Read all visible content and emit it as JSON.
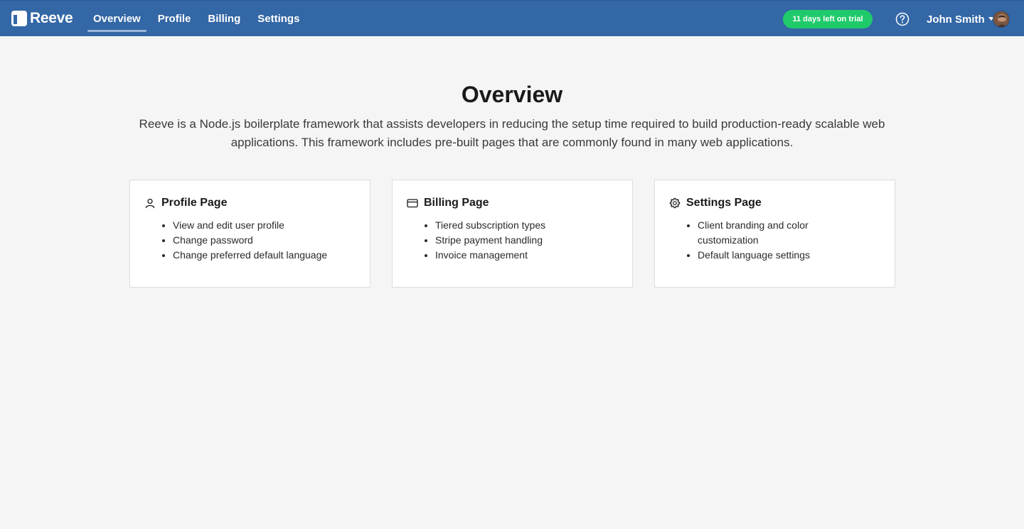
{
  "brand": {
    "name": "Reeve"
  },
  "nav": {
    "links": [
      {
        "label": "Overview"
      },
      {
        "label": "Profile"
      },
      {
        "label": "Billing"
      },
      {
        "label": "Settings"
      }
    ],
    "active": "Overview",
    "trial_badge": "11 days left on trial",
    "help_icon": "question-circle-icon",
    "user_name": "John Smith"
  },
  "main": {
    "title": "Overview",
    "description": "Reeve is a Node.js boilerplate framework that assists developers in reducing the setup time required to build production-ready scalable web applications. This framework includes pre-built pages that are commonly found in many web applications."
  },
  "cards": [
    {
      "icon": "user-icon",
      "title": "Profile Page",
      "items": [
        "View and edit user profile",
        "Change password",
        "Change preferred default language"
      ]
    },
    {
      "icon": "credit-card-icon",
      "title": "Billing Page",
      "items": [
        "Tiered subscription types",
        "Stripe payment handling",
        "Invoice management"
      ]
    },
    {
      "icon": "gear-icon",
      "title": "Settings Page",
      "items": [
        "Client branding and color customization",
        "Default language settings"
      ]
    }
  ],
  "colors": {
    "navbar": "#3367a6",
    "trial_badge": "#1fca6b",
    "background": "#f5f5f5"
  }
}
